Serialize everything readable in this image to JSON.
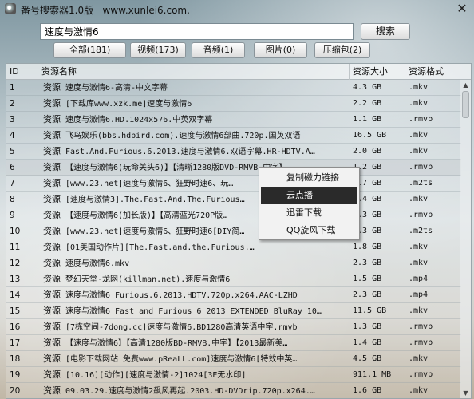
{
  "window": {
    "title": "番号搜索器1.0版   www.xunlei6.com.",
    "close": "✕"
  },
  "search": {
    "value": "速度与激情6",
    "button": "搜索"
  },
  "tabs": [
    {
      "label": "全部(181)"
    },
    {
      "label": "视频(173)"
    },
    {
      "label": "音频(1)"
    },
    {
      "label": "图片(0)"
    },
    {
      "label": "压缩包(2)"
    }
  ],
  "table": {
    "headers": {
      "id": "ID",
      "name": "资源名称",
      "size": "资源大小",
      "format": "资源格式"
    },
    "rows": [
      {
        "id": "1",
        "kind": "资源",
        "name": "速度与激情6-高清-中文字幕",
        "size": "4.3 GB",
        "format": ".mkv"
      },
      {
        "id": "2",
        "kind": "资源",
        "name": "[下载库www.xzk.me]速度与激情6",
        "size": "2.2 GB",
        "format": ".mkv"
      },
      {
        "id": "3",
        "kind": "资源",
        "name": "速度与激情6.HD.1024x576.中英双字幕",
        "size": "1.1 GB",
        "format": ".rmvb"
      },
      {
        "id": "4",
        "kind": "资源",
        "name": "飞鸟娱乐(bbs.hdbird.com).速度与激情6部曲.720p.国英双语",
        "size": "16.5 GB",
        "format": ".mkv"
      },
      {
        "id": "5",
        "kind": "资源",
        "name": "Fast.And.Furious.6.2013.速度与激情6.双语字幕.HR-HDTV.A…",
        "size": "2.0 GB",
        "format": ".mkv"
      },
      {
        "id": "6",
        "kind": "资源",
        "name": "【速度与激情6(玩命关头6)】【清晰1280版DVD-RMVB.中字】…",
        "size": "1.2 GB",
        "format": ".rmvb"
      },
      {
        "id": "7",
        "kind": "资源",
        "name": "[www.23.net]速度与激情6、狂野时速6、玩…",
        "size": "2.7 GB",
        "format": ".m2ts"
      },
      {
        "id": "8",
        "kind": "资源",
        "name": "[速度与激情3].The.Fast.And.The.Furious…",
        "size": "1.4 GB",
        "format": ".mkv"
      },
      {
        "id": "9",
        "kind": "资源",
        "name": "【速度与激情6(加长版)】【高清蓝光720P版…",
        "size": "4.3 GB",
        "format": ".rmvb"
      },
      {
        "id": "10",
        "kind": "资源",
        "name": "[www.23.net]速度与激情6、狂野时速6[DIY简…",
        "size": "4.3 GB",
        "format": ".m2ts"
      },
      {
        "id": "11",
        "kind": "资源",
        "name": "[01美国动作片][The.Fast.and.the.Furious.…",
        "size": "1.8 GB",
        "format": ".mkv"
      },
      {
        "id": "12",
        "kind": "资源",
        "name": "速度与激情6.mkv",
        "size": "2.3 GB",
        "format": ".mkv"
      },
      {
        "id": "13",
        "kind": "资源",
        "name": "梦幻天堂·龙网(killman.net).速度与激情6",
        "size": "1.5 GB",
        "format": ".mp4"
      },
      {
        "id": "14",
        "kind": "资源",
        "name": "速度与激情6 Furious.6.2013.HDTV.720p.x264.AAC-LZHD",
        "size": "2.3 GB",
        "format": ".mp4"
      },
      {
        "id": "15",
        "kind": "资源",
        "name": "速度与激情6 Fast and Furious 6 2013 EXTENDED BluRay 10…",
        "size": "11.5 GB",
        "format": ".mkv"
      },
      {
        "id": "16",
        "kind": "资源",
        "name": "[7栋空间-7dong.cc]速度与激情6.BD1280高清英语中字.rmvb",
        "size": "1.3 GB",
        "format": ".rmvb"
      },
      {
        "id": "17",
        "kind": "资源",
        "name": "【速度与激情6】【高清1280版BD-RMVB.中字】【2013最新美…",
        "size": "1.4 GB",
        "format": ".rmvb"
      },
      {
        "id": "18",
        "kind": "资源",
        "name": "[电影下载网站 免费www.pReaLL.com]速度与激情6[特效中英…",
        "size": "4.5 GB",
        "format": ".mkv"
      },
      {
        "id": "19",
        "kind": "资源",
        "name": "[10.16][动作][速度与激情-2]1024[3E无水印]",
        "size": "911.1 MB",
        "format": ".rmvb"
      },
      {
        "id": "20",
        "kind": "资源",
        "name": "09.03.29.速度与激情2飙风再起.2003.HD-DVDrip.720p.x264.…",
        "size": "1.6 GB",
        "format": ".mkv"
      }
    ]
  },
  "context_menu": {
    "items": [
      {
        "label": "复制磁力链接"
      },
      {
        "label": "云点播"
      },
      {
        "label": "迅雷下载"
      },
      {
        "label": "QQ旋风下载"
      }
    ]
  },
  "scrollbar": {
    "up": "▲",
    "down": "▼"
  }
}
